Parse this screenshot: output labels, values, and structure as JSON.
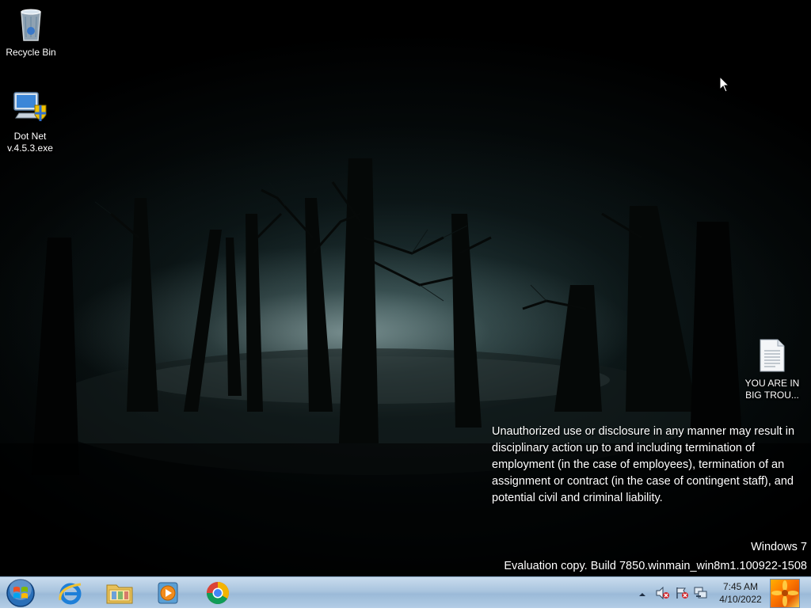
{
  "desktop": {
    "icons": [
      {
        "label": "Recycle Bin",
        "icon": "recycle-bin-icon"
      },
      {
        "label": "Dot Net v.4.5.3.exe",
        "line1": "Dot Net",
        "line2": "v.4.5.3.exe",
        "icon": "installer-icon"
      },
      {
        "label": "YOU ARE IN BIG TROU...",
        "line1": "YOU ARE IN",
        "line2": "BIG TROU...",
        "icon": "text-file-icon"
      }
    ],
    "legal_notice": "Unauthorized use or disclosure in any manner may result in disciplinary action up to and including termination of employment (in the case of employees), termination of an assignment or contract (in the case of contingent staff), and potential civil and criminal liability.",
    "watermark": {
      "os": "Windows 7",
      "build": "Evaluation copy. Build 7850.winmain_win8m1.100922-1508"
    }
  },
  "taskbar": {
    "start": {
      "icon": "windows-start-icon"
    },
    "pinned": [
      {
        "name": "Internet Explorer",
        "icon": "internet-explorer-icon"
      },
      {
        "name": "Windows Explorer",
        "icon": "folder-icon"
      },
      {
        "name": "Windows Media Player",
        "icon": "media-player-icon"
      },
      {
        "name": "Google Chrome",
        "icon": "chrome-icon"
      }
    ],
    "tray": {
      "icons": [
        "show-hidden-icons-icon",
        "volume-muted-icon",
        "action-center-icon",
        "network-icon"
      ],
      "time": "7:45 AM",
      "date": "4/10/2022"
    }
  },
  "colors": {
    "taskbar": "#a9c4de",
    "desktop_text": "#ffffff"
  }
}
